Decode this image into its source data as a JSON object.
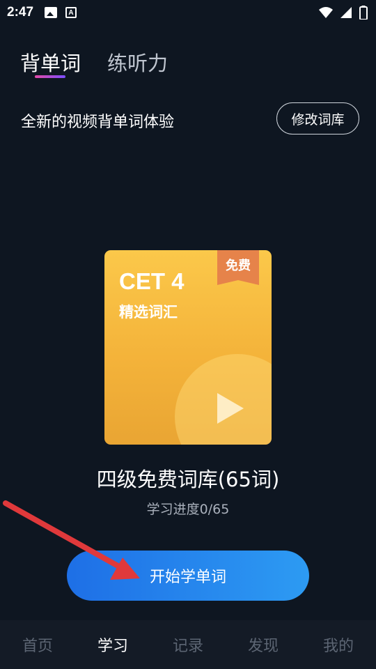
{
  "status_bar": {
    "time": "2:47",
    "icons": [
      "image-icon",
      "a-icon",
      "wifi-icon",
      "signal-icon",
      "battery-icon"
    ]
  },
  "tabs": [
    {
      "label": "背单词",
      "active": true
    },
    {
      "label": "练听力",
      "active": false
    }
  ],
  "subtitle": "全新的视频背单词体验",
  "edit_library_label": "修改词库",
  "book": {
    "title": "CET 4",
    "subtitle": "精选词汇",
    "ribbon": "免费"
  },
  "library_name": "四级免费词库(65词)",
  "progress": {
    "text": "学习进度0/65",
    "done": 0,
    "total": 65
  },
  "start_button_label": "开始学单词",
  "bottom_nav": [
    {
      "label": "首页",
      "active": false
    },
    {
      "label": "学习",
      "active": true
    },
    {
      "label": "记录",
      "active": false
    },
    {
      "label": "发现",
      "active": false
    },
    {
      "label": "我的",
      "active": false
    }
  ],
  "colors": {
    "background": "#0e1621",
    "accent_blue": "#1e6fe6",
    "card_yellow": "#f4b33a",
    "ribbon_orange": "#e6834a",
    "arrow_red": "#e0393b"
  }
}
